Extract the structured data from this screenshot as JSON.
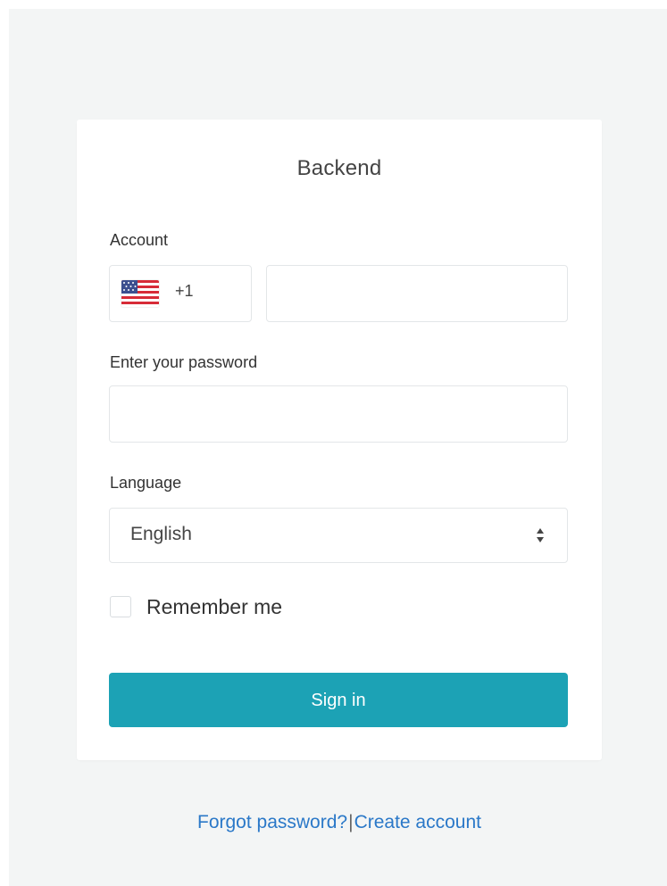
{
  "card": {
    "title": "Backend"
  },
  "form": {
    "account_label": "Account",
    "country_code": "+1",
    "account_value": "",
    "password_label": "Enter your password",
    "password_value": "",
    "language_label": "Language",
    "language_selected": "English",
    "remember_label": "Remember me",
    "remember_checked": false,
    "signin_label": "Sign in"
  },
  "footer": {
    "forgot_label": "Forgot password?",
    "separator": "|",
    "create_label": "Create account"
  },
  "colors": {
    "page_background": "#f3f5f5",
    "card_background": "#ffffff",
    "button_background": "#1ca2b5",
    "link_color": "#2a78c8"
  },
  "icons": {
    "flag": "us-flag-icon",
    "select": "updown-icon"
  }
}
